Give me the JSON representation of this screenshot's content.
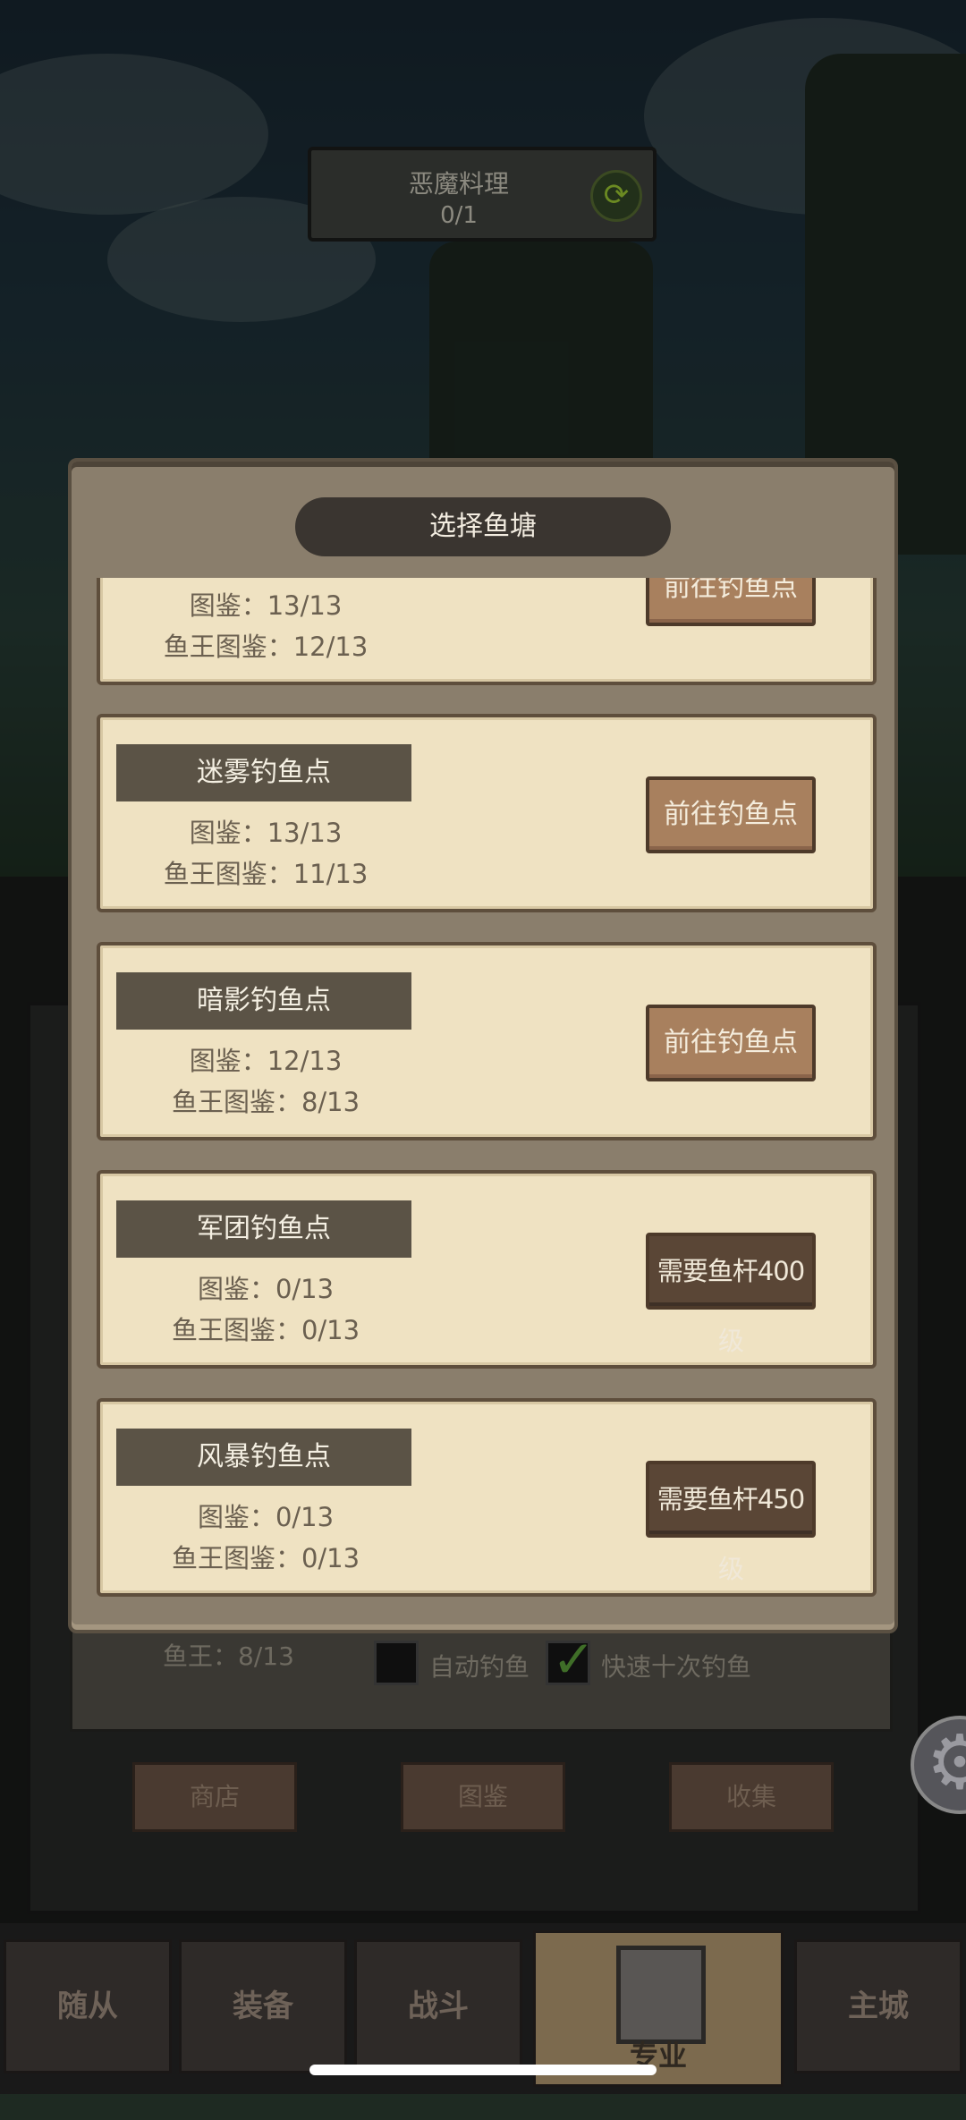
{
  "quest": {
    "title": "恶魔料理",
    "progress": "0/1",
    "refresh_icon": "refresh-icon"
  },
  "dialog": {
    "title": "选择鱼塘",
    "ponds": [
      {
        "name": "",
        "dex_label": "图鉴：13/13",
        "king_label": "鱼王图鉴：12/13",
        "button": "前往钓鱼点",
        "locked": false
      },
      {
        "name": "迷雾钓鱼点",
        "dex_label": "图鉴：13/13",
        "king_label": "鱼王图鉴：11/13",
        "button": "前往钓鱼点",
        "locked": false
      },
      {
        "name": "暗影钓鱼点",
        "dex_label": "图鉴：12/13",
        "king_label": "鱼王图鉴：8/13",
        "button": "前往钓鱼点",
        "locked": false
      },
      {
        "name": "军团钓鱼点",
        "dex_label": "图鉴：0/13",
        "king_label": "鱼王图鉴：0/13",
        "button": "需要鱼杆400级",
        "locked": true
      },
      {
        "name": "风暴钓鱼点",
        "dex_label": "图鉴：0/13",
        "king_label": "鱼王图鉴：0/13",
        "button": "需要鱼杆450级",
        "locked": true
      }
    ]
  },
  "background_panel": {
    "king_label": "鱼王：8/13",
    "auto_fish_label": "自动钓鱼",
    "auto_fish_checked": false,
    "fast_ten_label": "快速十次钓鱼",
    "fast_ten_checked": true,
    "buttons": [
      "商店",
      "图鉴",
      "收集"
    ]
  },
  "bottom_nav": {
    "tabs": [
      "随从",
      "装备",
      "战斗",
      "专业",
      "主城"
    ],
    "active": "专业"
  },
  "colors": {
    "card_bg": "#efe2c2",
    "dialog_frame": "#8a7e6c",
    "button_go": "#a8805e",
    "button_locked": "#5a4636"
  }
}
